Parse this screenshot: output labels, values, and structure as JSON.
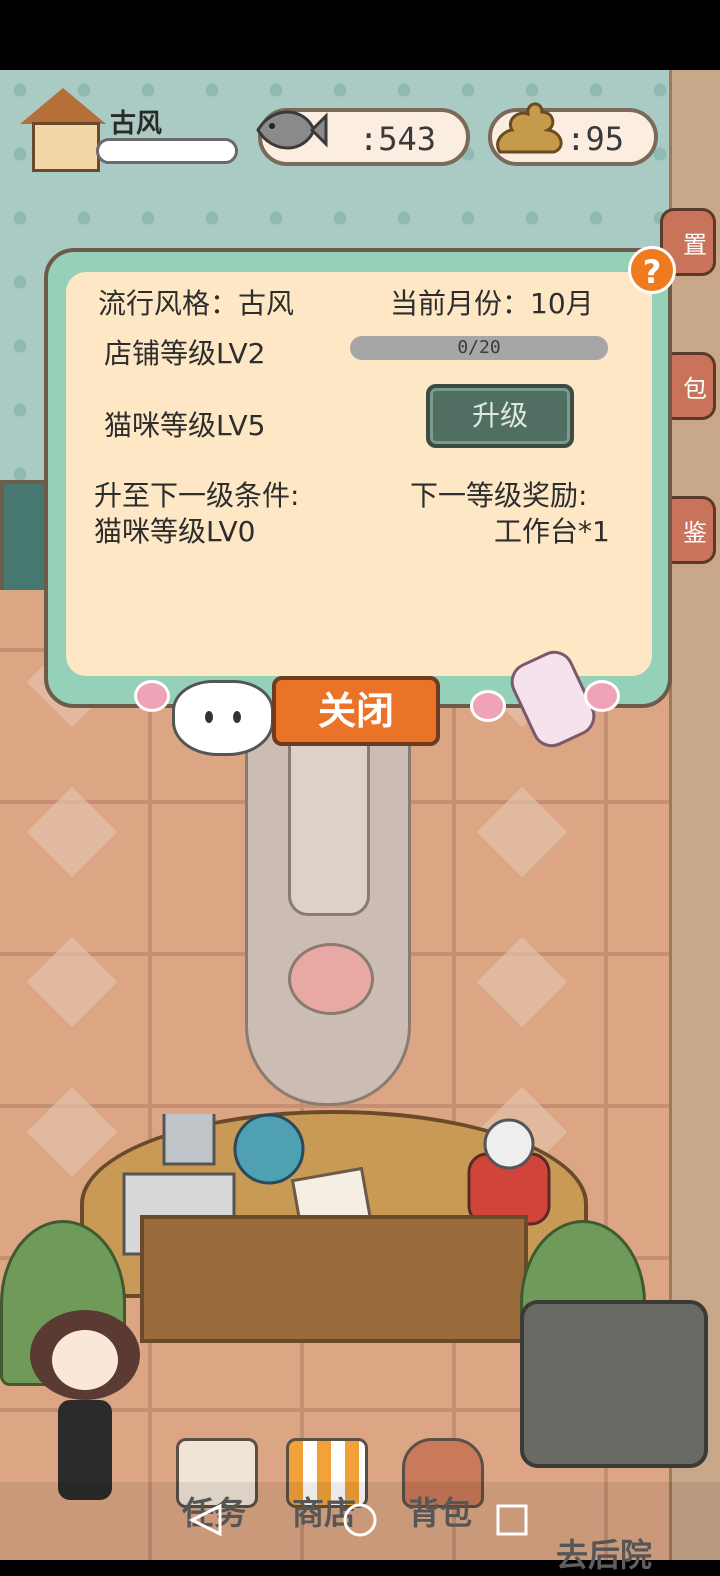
{
  "hud": {
    "player_name": "古风",
    "fish_count": ":543",
    "poop_count": ":95",
    "level_progress": 0.0
  },
  "dialog": {
    "style_label": "流行风格：古风",
    "month_label": "当前月份：10月",
    "shop_level": "店铺等级LV2",
    "shop_progress_text": "0/20",
    "shop_progress": 0.0,
    "cat_level": "猫咪等级LV5",
    "upgrade_button": "升级",
    "next_condition_title": "升至下一级条件:",
    "next_condition_value": "猫咪等级LV0",
    "next_reward_title": "下一等级奖励:",
    "next_reward_value": "工作台*1",
    "close_button": "关闭",
    "help_button": "?"
  },
  "side_icons": [
    {
      "label": "置",
      "icon": "gear-icon"
    },
    {
      "label": "包",
      "icon": "bag-icon"
    },
    {
      "label": "鉴",
      "icon": "book-icon"
    }
  ],
  "bottom_nav": {
    "tasks": "任务",
    "shop": "商店",
    "backpack": "背包",
    "backyard": "去后院"
  },
  "colors": {
    "dialog_border": "#95d0b8",
    "dialog_inner": "#fde7c5",
    "close_button": "#ea7327",
    "upgrade_button": "#516e62",
    "help_button": "#f07b1f"
  }
}
